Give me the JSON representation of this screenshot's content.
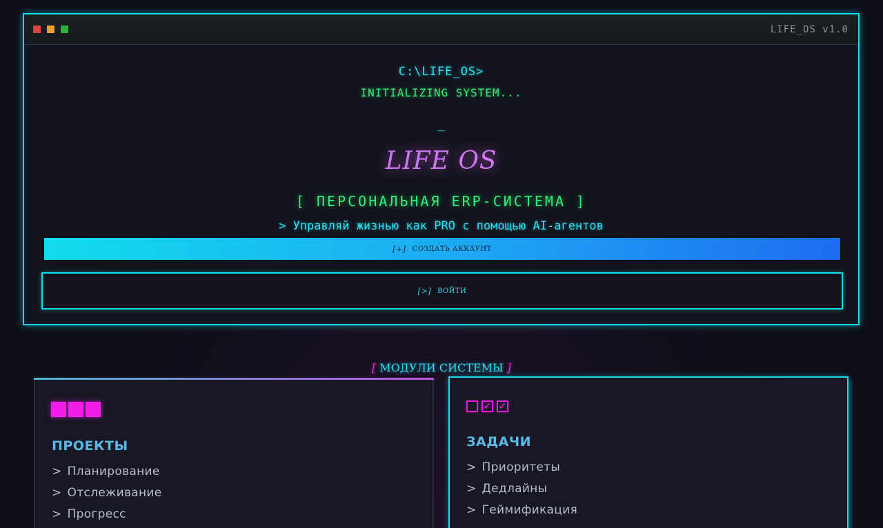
{
  "window": {
    "title": "LIFE_OS v1.0",
    "controls": [
      "close",
      "minimize",
      "maximize"
    ]
  },
  "terminal": {
    "prompt": "C:\\LIFE_OS>",
    "status": "INITIALIZING SYSTEM...",
    "cursor": "_",
    "logo": "LIFE OS",
    "subtitle": "[ ПЕРСОНАЛЬНАЯ ERP-СИСТЕМА ]",
    "tagline": "> Управляй жизнью как PRO с помощью AI-агентов"
  },
  "actions": {
    "create_account": {
      "icon": "[+]",
      "label": "СОЗДАТЬ АККАУНТ"
    },
    "login": {
      "icon": "[>]",
      "label": "ВОЙТИ"
    }
  },
  "modules": {
    "heading_open": "[",
    "heading": " МОДУЛИ СИСТЕМЫ ",
    "heading_close": "]",
    "cards": [
      {
        "title": "ПРОЕКТЫ",
        "icon": "three-blocks-icon",
        "items": [
          "Планирование",
          "Отслеживание",
          "Прогресс"
        ]
      },
      {
        "title": "ЗАДАЧИ",
        "icon": "checkbox-icons",
        "icon_glyphs": [
          "",
          "✓",
          "✓"
        ],
        "items": [
          "Приоритеты",
          "Дедлайны",
          "Геймификация"
        ]
      }
    ],
    "item_prefix": ">"
  },
  "colors": {
    "background": "#0d0e16",
    "cyan": "#18d8ec",
    "green": "#33f07a",
    "magenta": "#f01ee8",
    "logo_purple": "#d070f0",
    "card_title": "#5ab8e6",
    "button_gradient_start": "#12dcec",
    "button_gradient_end": "#1e6cf0"
  }
}
